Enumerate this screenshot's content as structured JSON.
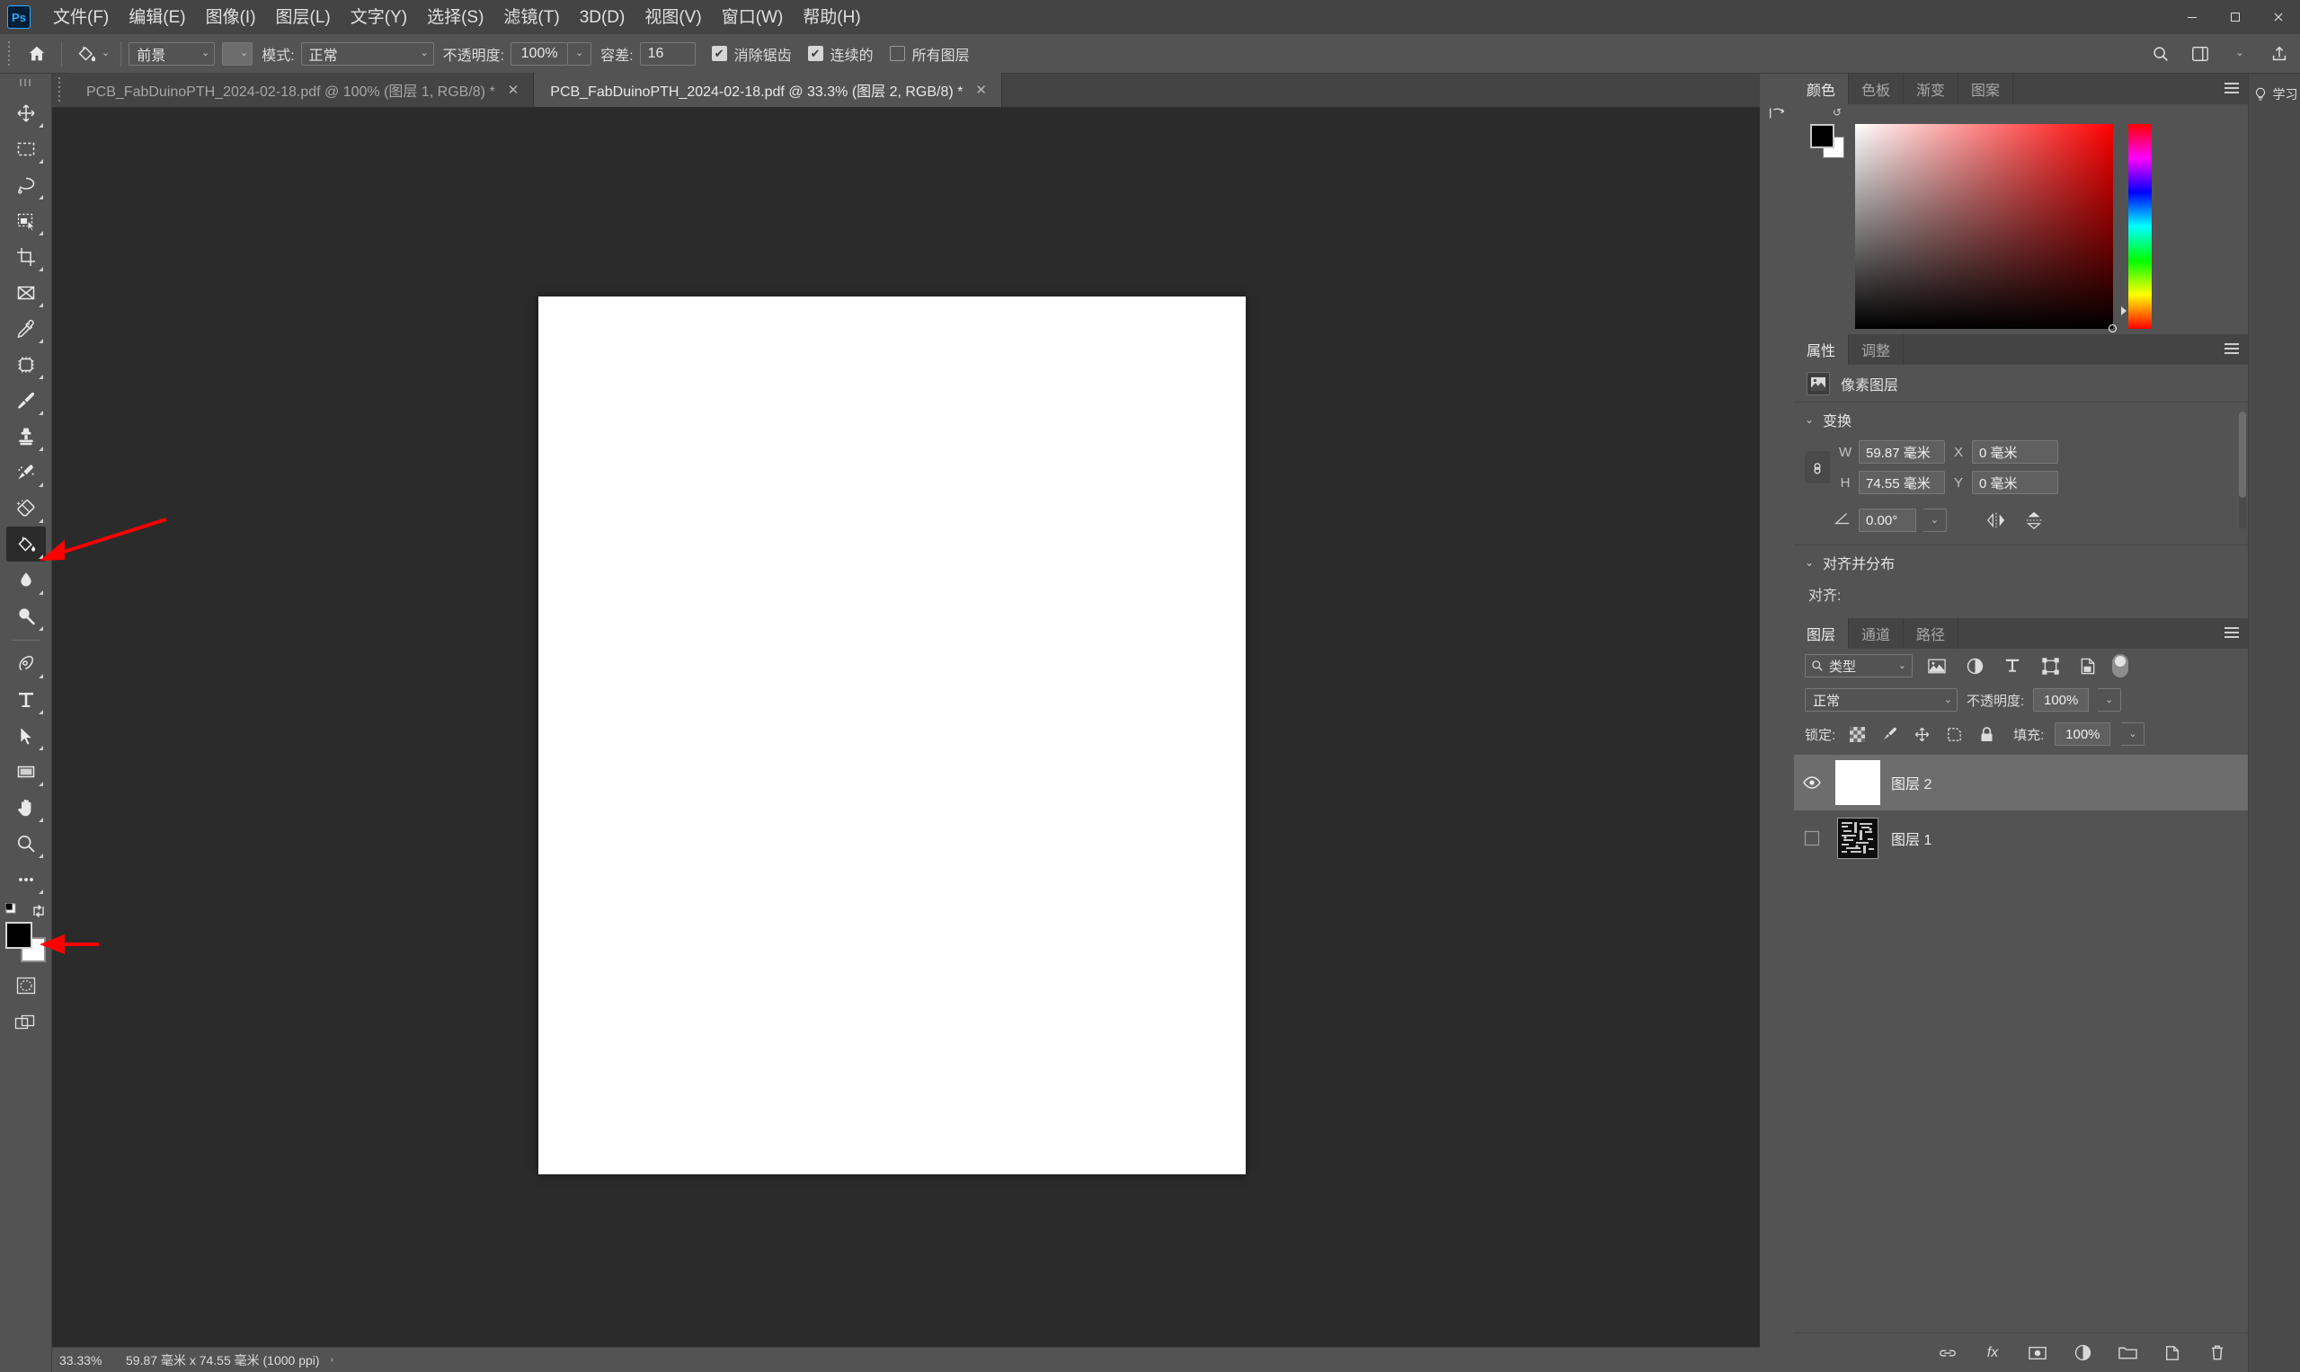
{
  "app": {
    "name": "Adobe Photoshop",
    "logo_text": "Ps"
  },
  "menubar": {
    "items": [
      {
        "label": "文件(F)",
        "name": "menu-file"
      },
      {
        "label": "编辑(E)",
        "name": "menu-edit"
      },
      {
        "label": "图像(I)",
        "name": "menu-image"
      },
      {
        "label": "图层(L)",
        "name": "menu-layer"
      },
      {
        "label": "文字(Y)",
        "name": "menu-type"
      },
      {
        "label": "选择(S)",
        "name": "menu-select"
      },
      {
        "label": "滤镜(T)",
        "name": "menu-filter"
      },
      {
        "label": "3D(D)",
        "name": "menu-3d"
      },
      {
        "label": "视图(V)",
        "name": "menu-view"
      },
      {
        "label": "窗口(W)",
        "name": "menu-window"
      },
      {
        "label": "帮助(H)",
        "name": "menu-help"
      }
    ],
    "window_controls": {
      "minimize": "—",
      "maximize": "▢",
      "close": "✕"
    }
  },
  "options_bar": {
    "tool": "paint-bucket-tool",
    "fill_source": "前景",
    "mode_label": "模式:",
    "mode_value": "正常",
    "opacity_label": "不透明度:",
    "opacity_value": "100%",
    "tolerance_label": "容差:",
    "tolerance_value": "16",
    "checkboxes": [
      {
        "label": "消除锯齿",
        "checked": true,
        "name": "antialias-checkbox"
      },
      {
        "label": "连续的",
        "checked": true,
        "name": "contiguous-checkbox"
      },
      {
        "label": "所有图层",
        "checked": false,
        "name": "all-layers-checkbox"
      }
    ]
  },
  "toolbox": {
    "tools": [
      {
        "name": "move-tool",
        "label": "移动工具"
      },
      {
        "name": "rectangular-marquee-tool",
        "label": "矩形选框工具"
      },
      {
        "name": "lasso-tool",
        "label": "套索工具"
      },
      {
        "name": "object-selection-tool",
        "label": "对象选择工具"
      },
      {
        "name": "crop-tool",
        "label": "裁剪工具"
      },
      {
        "name": "frame-tool",
        "label": "画框工具"
      },
      {
        "name": "eyedropper-tool",
        "label": "吸管工具"
      },
      {
        "name": "spot-healing-brush-tool",
        "label": "污点修复画笔工具"
      },
      {
        "name": "brush-tool",
        "label": "画笔工具"
      },
      {
        "name": "clone-stamp-tool",
        "label": "仿制图章工具"
      },
      {
        "name": "history-brush-tool",
        "label": "历史记录画笔工具"
      },
      {
        "name": "eraser-tool",
        "label": "橡皮擦工具"
      },
      {
        "name": "paint-bucket-tool",
        "label": "油漆桶工具",
        "active": true
      },
      {
        "name": "blur-tool",
        "label": "模糊工具"
      },
      {
        "name": "dodge-tool",
        "label": "减淡工具"
      },
      {
        "name": "pen-tool",
        "label": "钢笔工具"
      },
      {
        "name": "horizontal-type-tool",
        "label": "横排文字工具"
      },
      {
        "name": "path-selection-tool",
        "label": "路径选择工具"
      },
      {
        "name": "rectangle-tool",
        "label": "矩形工具"
      },
      {
        "name": "hand-tool",
        "label": "抓手工具"
      },
      {
        "name": "zoom-tool",
        "label": "缩放工具"
      },
      {
        "name": "edit-toolbar-button",
        "label": "编辑工具栏"
      }
    ],
    "foreground_color": "#000000",
    "background_color": "#ffffff"
  },
  "tabs": [
    {
      "label": "PCB_FabDuinoPTH_2024-02-18.pdf @ 100% (图层 1, RGB/8) *",
      "active": false,
      "close": "✕",
      "name": "doc-tab-1"
    },
    {
      "label": "PCB_FabDuinoPTH_2024-02-18.pdf @ 33.3% (图层 2, RGB/8) *",
      "active": true,
      "close": "✕",
      "name": "doc-tab-2"
    }
  ],
  "status_bar": {
    "zoom": "33.33%",
    "dimensions": "59.87 毫米 x 74.55 毫米 (1000 ppi)",
    "caret": "›"
  },
  "color_panel": {
    "tabs": [
      {
        "label": "颜色",
        "active": true,
        "name": "panel-tab-color"
      },
      {
        "label": "色板",
        "active": false,
        "name": "panel-tab-swatches"
      },
      {
        "label": "渐变",
        "active": false,
        "name": "panel-tab-gradients"
      },
      {
        "label": "图案",
        "active": false,
        "name": "panel-tab-patterns"
      }
    ],
    "foreground": "#000000",
    "background": "#ffffff"
  },
  "properties_panel": {
    "tabs": [
      {
        "label": "属性",
        "active": true,
        "name": "panel-tab-properties"
      },
      {
        "label": "调整",
        "active": false,
        "name": "panel-tab-adjustments"
      }
    ],
    "layer_kind": "像素图层",
    "transform": {
      "title": "变换",
      "w_label": "W",
      "w_value": "59.87 毫米",
      "h_label": "H",
      "h_value": "74.55 毫米",
      "x_label": "X",
      "x_value": "0 毫米",
      "y_label": "Y",
      "y_value": "0 毫米",
      "angle_value": "0.00°"
    },
    "align": {
      "title": "对齐并分布",
      "label": "对齐:",
      "buttons": [
        {
          "name": "align-left-edges"
        },
        {
          "name": "align-horizontal-centers"
        },
        {
          "name": "align-right-edges"
        },
        {
          "name": "align-top-edges"
        },
        {
          "name": "align-vertical-centers"
        },
        {
          "name": "align-bottom-edges"
        }
      ]
    }
  },
  "layers_panel": {
    "tabs": [
      {
        "label": "图层",
        "active": true,
        "name": "panel-tab-layers"
      },
      {
        "label": "通道",
        "active": false,
        "name": "panel-tab-channels"
      },
      {
        "label": "路径",
        "active": false,
        "name": "panel-tab-paths"
      }
    ],
    "filter_type": "类型",
    "filter_icons": [
      "pixel-filter-icon",
      "adjustment-filter-icon",
      "type-filter-icon",
      "shape-filter-icon",
      "smartobject-filter-icon"
    ],
    "blend_mode": "正常",
    "opacity_label": "不透明度:",
    "opacity_value": "100%",
    "lock_label": "锁定:",
    "fill_label": "填充:",
    "fill_value": "100%",
    "lock_icons": [
      "lock-transparent-pixels",
      "lock-image-pixels",
      "lock-position",
      "lock-artboard-nesting",
      "lock-all"
    ],
    "layers": [
      {
        "name": "图层 2",
        "visible": true,
        "selected": true,
        "thumb": "white"
      },
      {
        "name": "图层 1",
        "visible": false,
        "selected": false,
        "thumb": "pcb"
      }
    ],
    "footer_icons": [
      "link-layers-icon",
      "layer-style-icon",
      "layer-mask-icon",
      "new-fill-adjustment-icon",
      "new-group-icon",
      "new-layer-icon",
      "delete-layer-icon"
    ]
  },
  "right_rail": {
    "items": [
      {
        "label": "学习",
        "name": "rail-learn-button",
        "icon": "lightbulb-icon"
      }
    ]
  },
  "annotations": {
    "arrow1": "points to paint-bucket-tool",
    "arrow2": "points to foreground-color-swatch",
    "color": "#fe0000"
  }
}
